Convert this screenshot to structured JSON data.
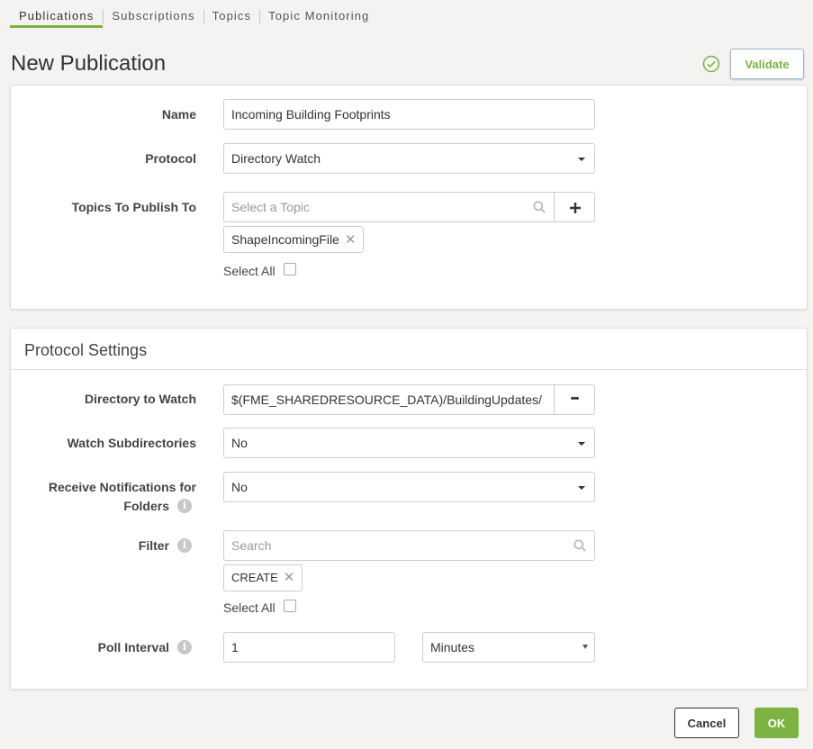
{
  "tabs": [
    {
      "label": "Publications",
      "active": true
    },
    {
      "label": "Subscriptions",
      "active": false
    },
    {
      "label": "Topics",
      "active": false
    },
    {
      "label": "Topic Monitoring",
      "active": false
    }
  ],
  "header": {
    "title": "New Publication",
    "validate_label": "Validate",
    "validated_icon": "check-circle-icon"
  },
  "general": {
    "name": {
      "label": "Name",
      "value": "Incoming Building Footprints"
    },
    "protocol": {
      "label": "Protocol",
      "value": "Directory Watch"
    },
    "topics": {
      "label": "Topics To Publish To",
      "placeholder": "Select a Topic",
      "add_icon": "plus-icon",
      "selected": [
        "ShapeIncomingFile"
      ],
      "select_all_label": "Select All"
    }
  },
  "protocol_settings": {
    "heading": "Protocol Settings",
    "directory": {
      "label": "Directory to Watch",
      "value": "$(FME_SHAREDRESOURCE_DATA)/BuildingUpdates/",
      "browse_label": "•••"
    },
    "watch_subdirectories": {
      "label": "Watch Subdirectories",
      "value": "No"
    },
    "receive_notifications": {
      "label_line1": "Receive Notifications for",
      "label_line2": "Folders",
      "value": "No"
    },
    "filter": {
      "label": "Filter",
      "placeholder": "Search",
      "selected": [
        "CREATE"
      ],
      "select_all_label": "Select All"
    },
    "poll_interval": {
      "label": "Poll Interval",
      "value": "1",
      "unit": "Minutes"
    }
  },
  "footer": {
    "cancel_label": "Cancel",
    "ok_label": "OK"
  },
  "colors": {
    "accent_green": "#7cb342",
    "background": "#f4f3f1"
  }
}
